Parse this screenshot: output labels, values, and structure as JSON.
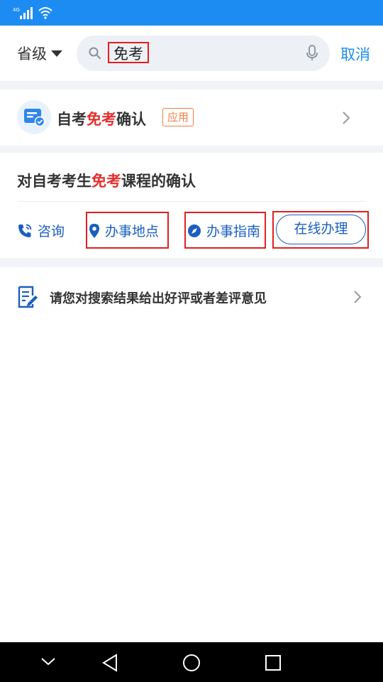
{
  "status_bar": {
    "network": "4G"
  },
  "header": {
    "province_label": "省级",
    "search_value": "免考",
    "cancel_label": "取消"
  },
  "app_result": {
    "title_pre": "自考",
    "title_hl": "免考",
    "title_post": "确认",
    "badge": "应用"
  },
  "service": {
    "title_pre": "对自考考生",
    "title_hl": "免考",
    "title_post": "课程的确认",
    "actions": {
      "consult": "咨询",
      "location": "办事地点",
      "guide": "办事指南",
      "online": "在线办理"
    }
  },
  "feedback": {
    "text": "请您对搜索结果给出好评或者差评意见"
  },
  "colors": {
    "primary": "#1c8cf2",
    "highlight": "#e52d2d",
    "badge": "#f07f45",
    "annotation": "#e02020"
  }
}
